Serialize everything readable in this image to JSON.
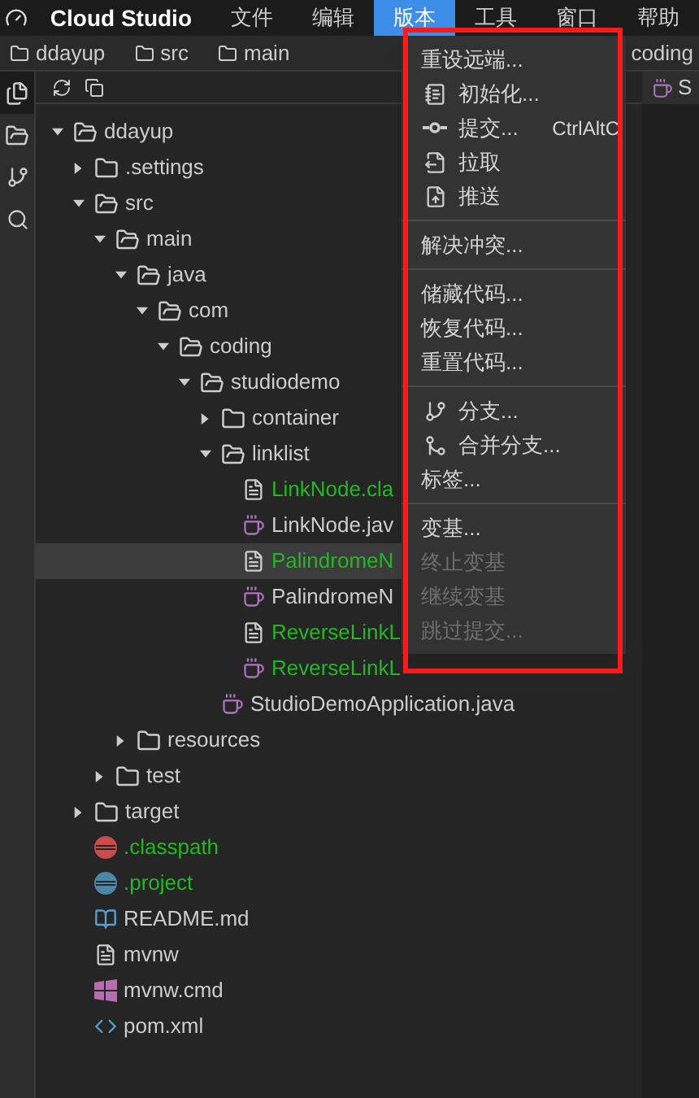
{
  "menubar": {
    "app_name": "Cloud Studio",
    "menus": [
      {
        "label": "文件",
        "selected": false
      },
      {
        "label": "编辑",
        "selected": false
      },
      {
        "label": "版本",
        "selected": true
      },
      {
        "label": "工具",
        "selected": false
      },
      {
        "label": "窗口",
        "selected": false
      },
      {
        "label": "帮助",
        "selected": false
      }
    ]
  },
  "breadcrumbs": [
    "ddayup",
    "src",
    "main",
    "coding"
  ],
  "activity_bar": [
    {
      "kind": "files",
      "selected": true
    },
    {
      "kind": "folder",
      "selected": false
    },
    {
      "kind": "branch",
      "selected": false
    },
    {
      "kind": "search",
      "selected": false
    }
  ],
  "tree": [
    {
      "name": "ddayup",
      "kind": "folder",
      "expanded": true,
      "selected": false,
      "children": [
        {
          "name": ".settings",
          "kind": "folder",
          "expanded": false,
          "selected": false
        },
        {
          "name": "src",
          "kind": "folder",
          "expanded": true,
          "selected": false,
          "children": [
            {
              "name": "main",
              "kind": "folder",
              "expanded": true,
              "selected": false,
              "children": [
                {
                  "name": "java",
                  "kind": "folder",
                  "expanded": true,
                  "selected": false,
                  "children": [
                    {
                      "name": "com",
                      "kind": "folder",
                      "expanded": true,
                      "selected": false,
                      "children": [
                        {
                          "name": "coding",
                          "kind": "folder",
                          "expanded": true,
                          "selected": false,
                          "children": [
                            {
                              "name": "studiodemo",
                              "kind": "folder",
                              "expanded": true,
                              "selected": false,
                              "children": [
                                {
                                  "name": "container",
                                  "kind": "folder",
                                  "expanded": false,
                                  "selected": false
                                },
                                {
                                  "name": "linklist",
                                  "kind": "folder",
                                  "expanded": true,
                                  "selected": false,
                                  "children": [
                                    {
                                      "name": "LinkNode.cla",
                                      "kind": "file",
                                      "color": "#22b822",
                                      "selected": false
                                    },
                                    {
                                      "name": "LinkNode.jav",
                                      "kind": "java",
                                      "color": "#cccccc",
                                      "selected": false
                                    },
                                    {
                                      "name": "PalindromeN",
                                      "kind": "file",
                                      "color": "#22b822",
                                      "selected": true
                                    },
                                    {
                                      "name": "PalindromeN",
                                      "kind": "java",
                                      "color": "#cccccc",
                                      "selected": false
                                    },
                                    {
                                      "name": "ReverseLinkL",
                                      "kind": "file",
                                      "color": "#22b822",
                                      "selected": false
                                    },
                                    {
                                      "name": "ReverseLinkL",
                                      "kind": "java",
                                      "color": "#22b822",
                                      "selected": false
                                    }
                                  ]
                                },
                                {
                                  "name": "StudioDemoApplication.java",
                                  "kind": "java",
                                  "color": "#cccccc",
                                  "selected": false
                                }
                              ]
                            }
                          ]
                        }
                      ]
                    }
                  ]
                },
                {
                  "name": "resources",
                  "kind": "folder",
                  "expanded": false,
                  "selected": false
                }
              ]
            },
            {
              "name": "test",
              "kind": "folder",
              "expanded": false,
              "selected": false
            }
          ]
        },
        {
          "name": "target",
          "kind": "folder",
          "expanded": false,
          "selected": false
        },
        {
          "name": ".classpath",
          "kind": "eclipse-red",
          "color": "#22b822",
          "selected": false
        },
        {
          "name": ".project",
          "kind": "eclipse-blue",
          "color": "#22b822",
          "selected": false
        },
        {
          "name": "README.md",
          "kind": "readme",
          "color": "#cccccc",
          "selected": false
        },
        {
          "name": "mvnw",
          "kind": "file",
          "color": "#cccccc",
          "selected": false
        },
        {
          "name": "mvnw.cmd",
          "kind": "windows",
          "color": "#cccccc",
          "selected": false
        },
        {
          "name": "pom.xml",
          "kind": "xml",
          "color": "#cccccc",
          "selected": false
        }
      ]
    }
  ],
  "editor_tab": {
    "label": "S"
  },
  "version_menu": [
    {
      "kind": "item",
      "label": "重设远端...",
      "disabled": false
    },
    {
      "kind": "init",
      "label": "初始化...",
      "disabled": false
    },
    {
      "kind": "commit",
      "label": "提交...",
      "shortcut": "CtrlAltC",
      "disabled": false
    },
    {
      "kind": "pull",
      "label": "拉取",
      "disabled": false
    },
    {
      "kind": "push",
      "label": "推送",
      "disabled": false
    },
    {
      "kind": "separator"
    },
    {
      "kind": "item",
      "label": "解决冲突...",
      "disabled": false
    },
    {
      "kind": "separator"
    },
    {
      "kind": "item",
      "label": "储藏代码...",
      "disabled": false
    },
    {
      "kind": "item",
      "label": "恢复代码...",
      "disabled": false
    },
    {
      "kind": "item",
      "label": "重置代码...",
      "disabled": false
    },
    {
      "kind": "separator"
    },
    {
      "kind": "branch",
      "label": "分支...",
      "disabled": false
    },
    {
      "kind": "merge",
      "label": "合并分支...",
      "disabled": false
    },
    {
      "kind": "item",
      "label": "标签...",
      "disabled": false
    },
    {
      "kind": "separator"
    },
    {
      "kind": "item",
      "label": "变基...",
      "disabled": false
    },
    {
      "kind": "item",
      "label": "终止变基",
      "disabled": true
    },
    {
      "kind": "item",
      "label": "继续变基",
      "disabled": true
    },
    {
      "kind": "item",
      "label": "跳过提交...",
      "disabled": true
    }
  ],
  "highlight_frame": true
}
